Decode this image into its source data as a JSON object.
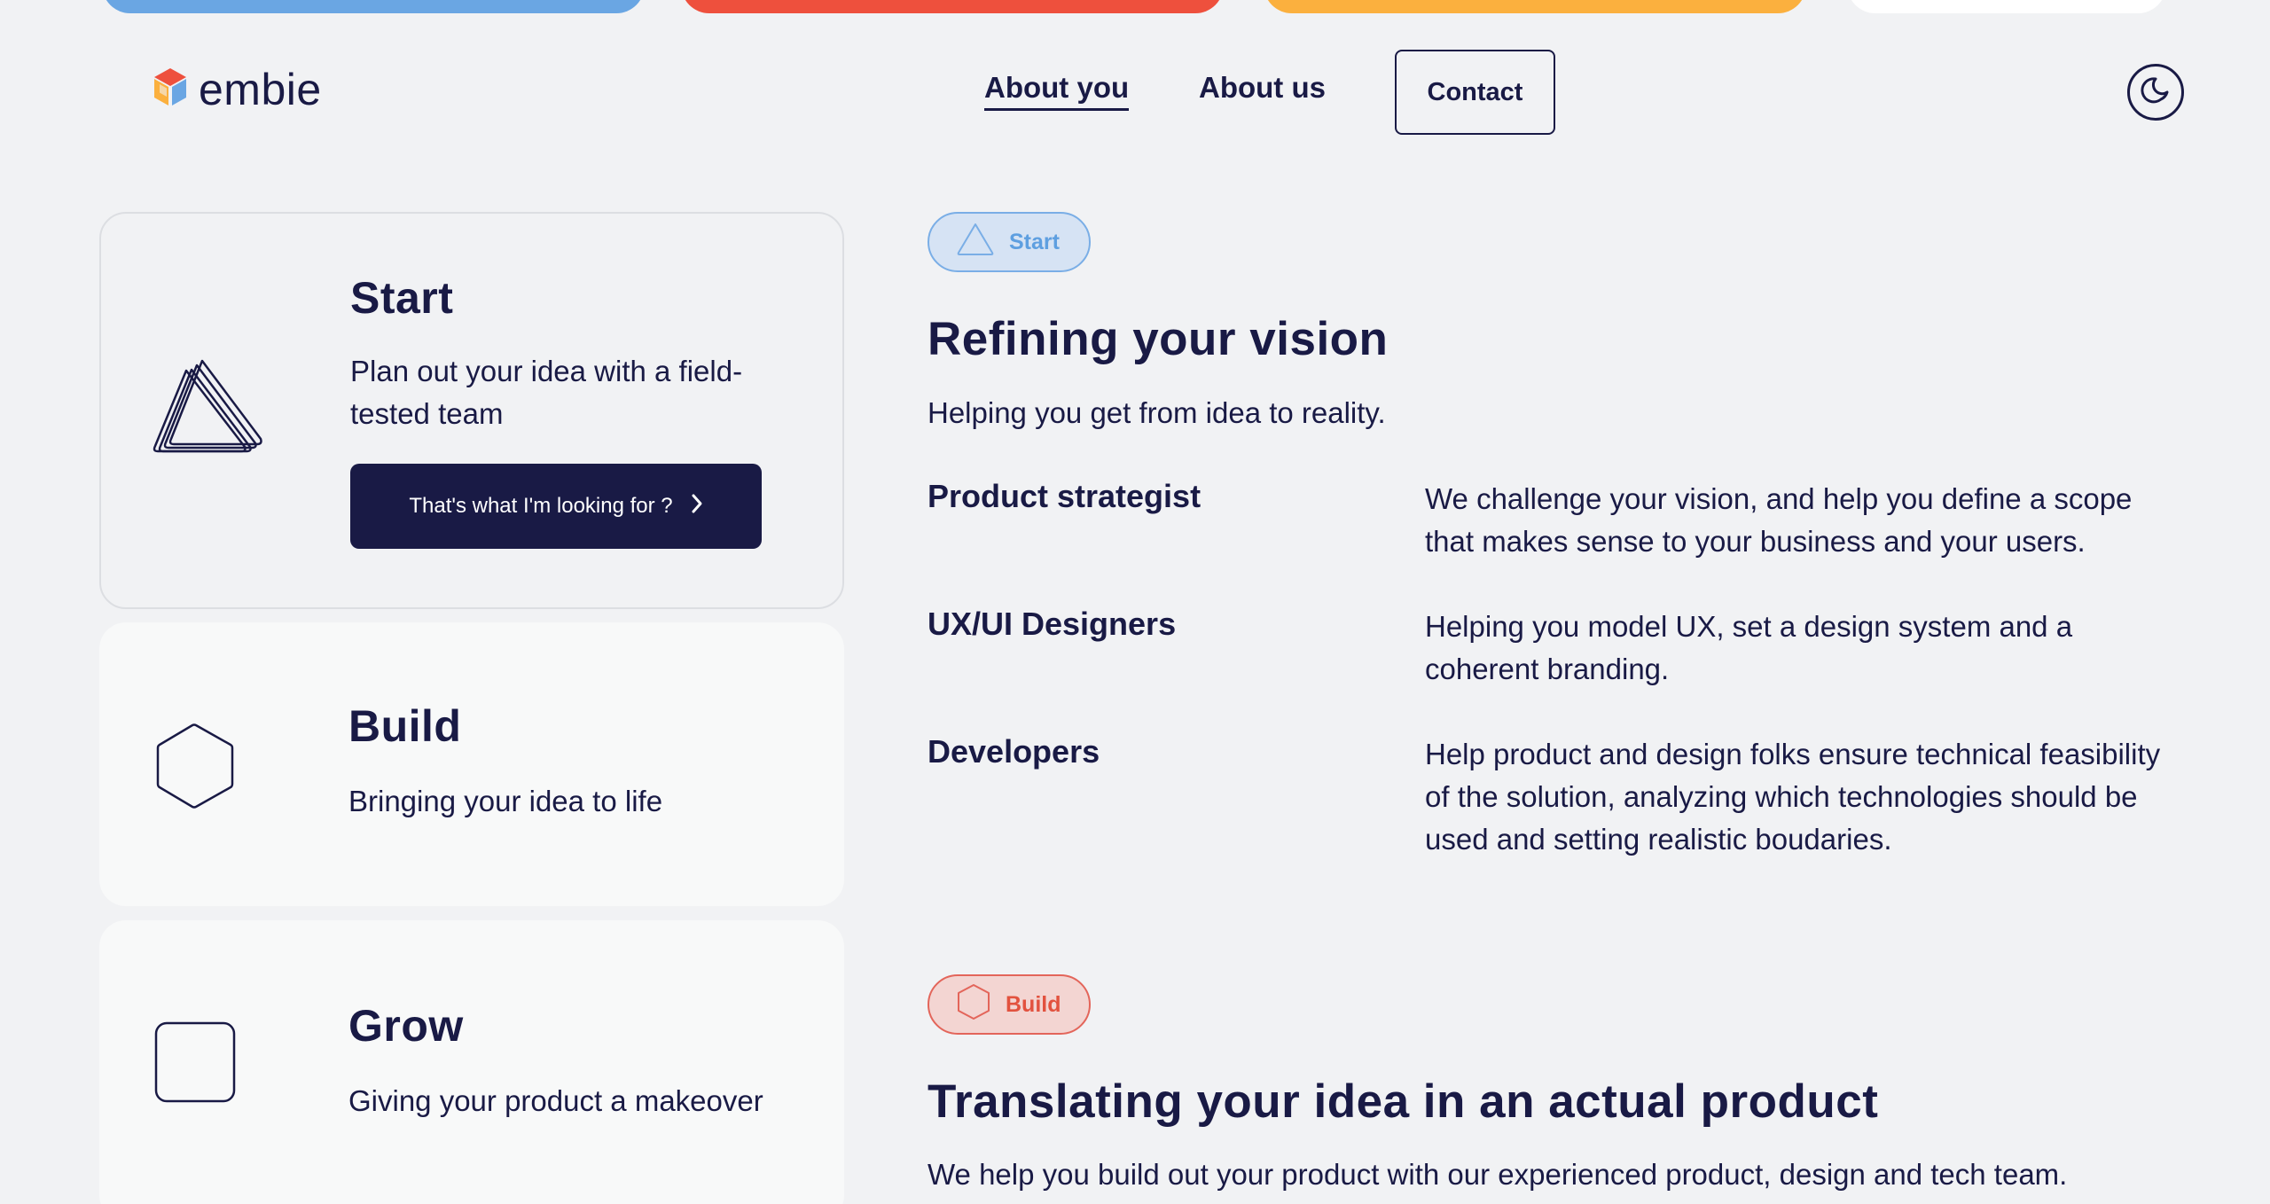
{
  "colors": {
    "bar_blue": "#6aa6e3",
    "bar_red": "#ee503d",
    "bar_yellow": "#fbb03e",
    "bar_white": "#ffffff",
    "navy": "#191a45",
    "start_accent": "#5e9fe0",
    "build_accent": "#e2523f"
  },
  "header": {
    "logo_text": "embie",
    "nav": {
      "about_you": "About you",
      "about_us": "About us",
      "contact": "Contact"
    },
    "theme_toggle_icon": "moon-icon"
  },
  "cards": [
    {
      "title": "Start",
      "description": "Plan out your idea with a field-tested team",
      "cta": "That's what I'm looking for ?",
      "cta_icon": "chevron-right-icon",
      "icon": "triangle-stack-icon"
    },
    {
      "title": "Build",
      "description": "Bringing your idea to life",
      "icon": "hexagon-icon"
    },
    {
      "title": "Grow",
      "description": "Giving your product a makeover",
      "icon": "rounded-square-icon"
    }
  ],
  "sections": {
    "start": {
      "badge": "Start",
      "badge_icon": "triangle-icon",
      "title": "Refining your vision",
      "subtitle": "Helping you get from idea to reality.",
      "roles": [
        {
          "name": "Product strategist",
          "description": "We challenge your vision, and help you define a scope that makes sense to your business and your users."
        },
        {
          "name": "UX/UI Designers",
          "description": "Helping you model UX, set a design system and a coherent branding."
        },
        {
          "name": "Developers",
          "description": "Help product and design folks ensure technical feasibility of the solution, analyzing which technologies should be used and setting realistic boudaries."
        }
      ]
    },
    "build": {
      "badge": "Build",
      "badge_icon": "hexagon-icon",
      "title": "Translating your idea in an actual product",
      "subtitle": "We help you build out your product with our experienced product, design and tech team."
    }
  }
}
